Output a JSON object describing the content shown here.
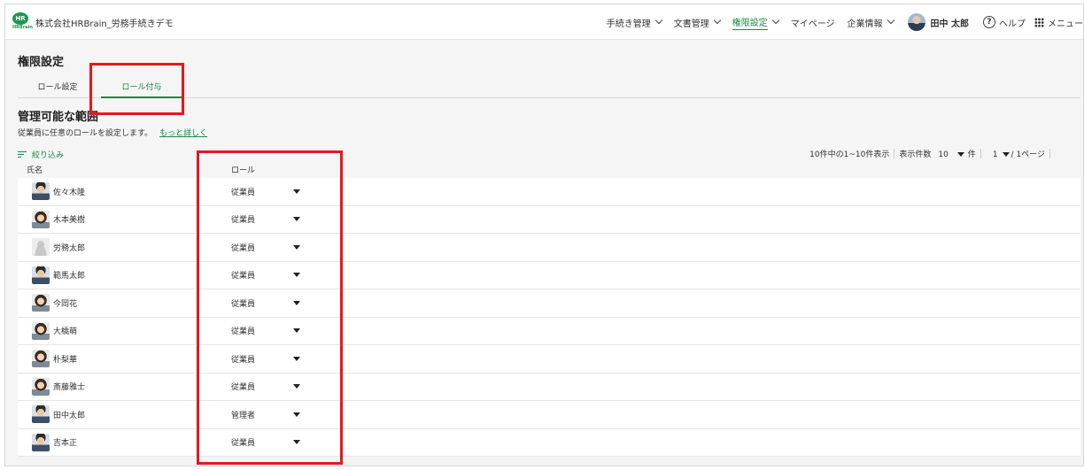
{
  "header": {
    "company": "株式会社HRBrain_労務手続きデモ",
    "logo_text": "HR",
    "logo_sub": "HRBrain",
    "nav": [
      {
        "label": "手続き管理"
      },
      {
        "label": "文書管理"
      },
      {
        "label": "権限設定"
      },
      {
        "label": "マイページ"
      },
      {
        "label": "企業情報"
      }
    ],
    "user_name": "田中 太郎",
    "help_label": "ヘルプ",
    "menu_label": "メニュー"
  },
  "page": {
    "title": "権限設定",
    "tabs": [
      {
        "label": "ロール設定"
      },
      {
        "label": "ロール付与"
      }
    ],
    "section_title": "管理可能な範囲",
    "description": "従業員に任意のロールを設定します。",
    "more_link": "もっと詳しく",
    "filter_label": "絞り込み"
  },
  "pager": {
    "summary": "10件中の1~10件表示",
    "per_page_label": "表示件数",
    "per_page_value": "10",
    "per_page_unit": "件",
    "current_page": "1",
    "page_total": "/ 1ページ"
  },
  "table": {
    "columns": {
      "name": "氏名",
      "role": "ロール"
    },
    "rows": [
      {
        "name": "佐々木隆",
        "role": "従業員"
      },
      {
        "name": "木本美樹",
        "role": "従業員"
      },
      {
        "name": "労務太郎",
        "role": "従業員"
      },
      {
        "name": "範馬太郎",
        "role": "従業員"
      },
      {
        "name": "今岡花",
        "role": "従業員"
      },
      {
        "name": "大橋萌",
        "role": "従業員"
      },
      {
        "name": "朴梨華",
        "role": "従業員"
      },
      {
        "name": "斎藤雅士",
        "role": "従業員"
      },
      {
        "name": "田中太郎",
        "role": "管理者"
      },
      {
        "name": "吉本正",
        "role": "従業員"
      }
    ]
  },
  "colors": {
    "accent": "#1a8a3f",
    "highlight": "#e8171d"
  }
}
